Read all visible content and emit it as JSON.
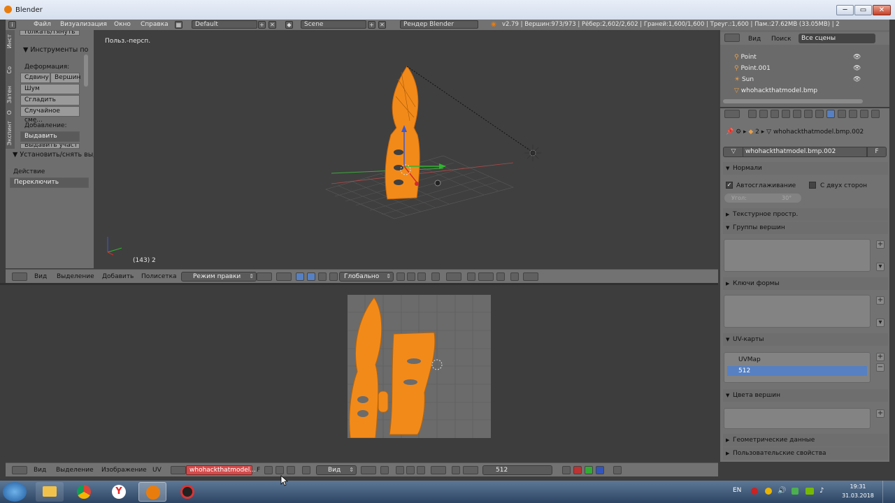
{
  "window": {
    "title": "Blender",
    "min": "─",
    "max": "▭",
    "close": "✕"
  },
  "info_header": {
    "menus": [
      "Файл",
      "Визуализация",
      "Окно",
      "Справка"
    ],
    "layout": "Default",
    "scene": "Scene",
    "engine": "Рендер Blender",
    "stats": "v2.79 | Вершин:973/973 | Рёбер:2,602/2,602 | Граней:1,600/1,600 | Треуг.:1,600 | Пам.:27.62MB (33.05MB) | 2"
  },
  "toolshelf": {
    "tabs": [
      "Инст",
      "Со",
      "Затен",
      "О",
      "Экспинт"
    ],
    "top_cut": "толкать/тянуть",
    "section": "Инструменты по",
    "deform_label": "Деформация:",
    "btn_slide": "Сдвину",
    "btn_vertex": "Вершин",
    "btn_noise": "Шум",
    "btn_smooth": "Сгладить верш...",
    "btn_random": "Случайное сме...",
    "add_label": "Добавление:",
    "extrude": "Выдавить",
    "extrude_cut": "Выдавить участ",
    "operator_section": "Установить/снять выд",
    "action_label": "Действие",
    "action_value": "Переключить"
  },
  "viewport3d": {
    "view_name": "Польз.-персп.",
    "frame_info": "(143) 2",
    "header": {
      "menus": [
        "Вид",
        "Выделение",
        "Добавить",
        "Полисетка"
      ],
      "mode": "Режим правки",
      "orientation": "Глобально"
    }
  },
  "outliner": {
    "menu_view": "Вид",
    "menu_search": "Поиск",
    "filter": "Все сцены",
    "items": [
      "Point",
      "Point.001",
      "Sun",
      "whohackthatmodel.bmp"
    ]
  },
  "properties": {
    "breadcrumb_num": "2",
    "breadcrumb_obj": "whohackthatmodel.bmp.002",
    "mesh_name": "whohackthatmodel.bmp.002",
    "fake_user": "F",
    "sections": {
      "normals": "Нормали",
      "autosmooth": "Автосглаживание",
      "double_sided": "С двух сторон",
      "angle_label": "Угол:",
      "angle_value": "30°",
      "texture_space": "Текстурное простр.",
      "vertex_groups": "Группы вершин",
      "shape_keys": "Ключи формы",
      "uv_maps": "UV-карты",
      "uv_items": [
        "UVMap",
        "512"
      ],
      "vertex_colors": "Цвета вершин",
      "geometry_data": "Геометрические данные",
      "custom_props": "Пользовательские свойства"
    }
  },
  "uv_editor": {
    "header": {
      "menus": [
        "Вид",
        "Выделение",
        "Изображение",
        "UV"
      ],
      "image_name": "whohackthatmodel...",
      "fake": "F",
      "view_mode": "Вид",
      "uv_map": "512"
    }
  },
  "taskbar": {
    "lang": "EN",
    "time": "19:31",
    "date": "31.03.2018"
  },
  "colors": {
    "accent_orange": "#f28a1a",
    "selected_blue": "#5680c2",
    "uv_image_red": "#d34b4b"
  }
}
